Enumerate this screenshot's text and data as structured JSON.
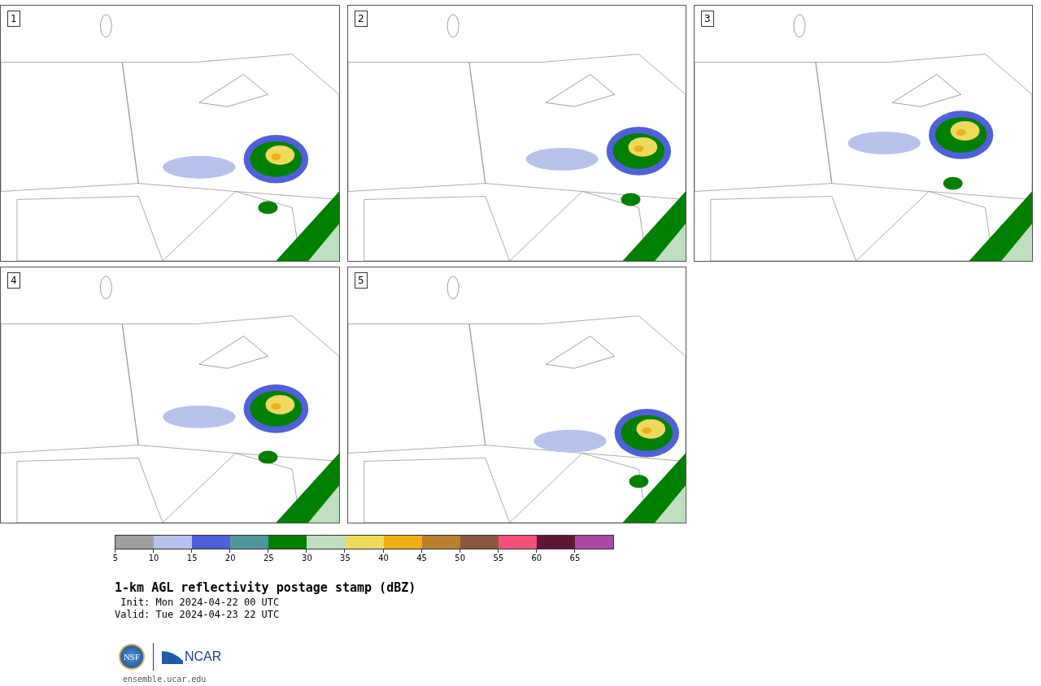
{
  "panels": [
    {
      "number": "1",
      "kind": "picture"
    },
    {
      "number": "2",
      "kind": "picture"
    },
    {
      "number": "3",
      "kind": "picture"
    },
    {
      "number": "4",
      "kind": "picture"
    },
    {
      "number": "5",
      "kind": "picture"
    }
  ],
  "colorbar": {
    "segments": [
      {
        "color": "#a0a0a0",
        "tick": "5"
      },
      {
        "color": "#b8c2ec",
        "tick": "10"
      },
      {
        "color": "#5060d8",
        "tick": "15"
      },
      {
        "color": "#4f979d",
        "tick": "20"
      },
      {
        "color": "#008000",
        "tick": "25"
      },
      {
        "color": "#bfdfc0",
        "tick": "30"
      },
      {
        "color": "#efd95b",
        "tick": "35"
      },
      {
        "color": "#f0ae18",
        "tick": "40"
      },
      {
        "color": "#ba8030",
        "tick": "45"
      },
      {
        "color": "#8a5a3c",
        "tick": "50"
      },
      {
        "color": "#f4507c",
        "tick": "55"
      },
      {
        "color": "#601535",
        "tick": "60"
      },
      {
        "color": "#ab4aa6",
        "tick": "65"
      }
    ]
  },
  "title": "1-km AGL reflectivity postage stamp (dBZ)",
  "init": "Init: Mon 2024-04-22 00 UTC",
  "valid": "Valid: Tue 2024-04-23 22 UTC",
  "logos": {
    "nsf": "NSF",
    "ncar": "NCAR"
  },
  "url": "ensemble.ucar.edu"
}
